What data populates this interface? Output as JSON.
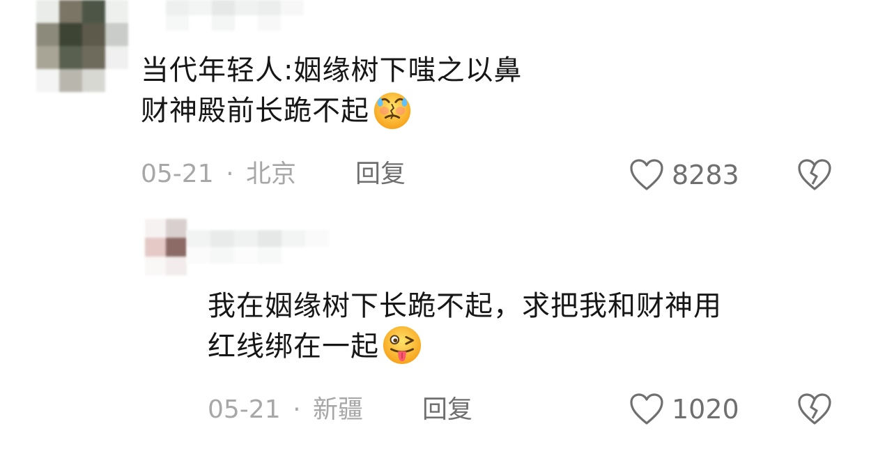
{
  "comments": [
    {
      "text_line1": "当代年轻人:姻缘树下嗤之以鼻",
      "text_line2": "财神殿前长跪不起",
      "emoji": "crying-face-emoji",
      "date": "05-21",
      "separator": "·",
      "location": "北京",
      "reply_label": "回复",
      "likes": "8283"
    },
    {
      "text_line1": "我在姻缘树下长跪不起，求把我和财神用",
      "text_line2": "红线绑在一起",
      "emoji": "winking-tongue-face-emoji",
      "date": "05-21",
      "separator": "·",
      "location": "新疆",
      "reply_label": "回复",
      "likes": "1020"
    }
  ],
  "icons": {
    "like": "heart-outline-icon",
    "dislike": "broken-heart-icon"
  },
  "colors": {
    "text": "#161616",
    "meta": "#a7a7a7",
    "action": "#6f6f6f"
  }
}
